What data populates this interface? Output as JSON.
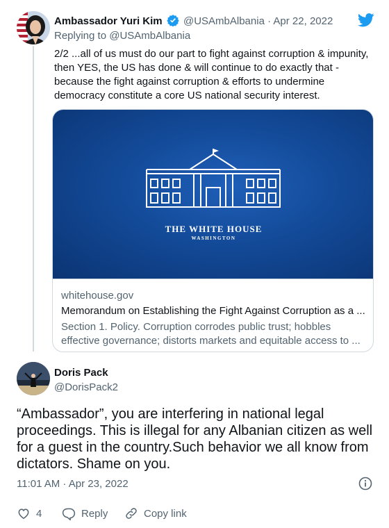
{
  "tweet1": {
    "display_name": "Ambassador Yuri Kim",
    "handle_date": "@USAmbAlbania · Apr 22, 2022",
    "replying_prefix": "Replying to ",
    "replying_handle": "@USAmbAlbania",
    "text": "2/2 ...all of us must do our part to fight against corruption & impunity, then YES, the US has done & will continue to do exactly that - because the fight against corruption & efforts to undermine democracy constitute a core US national security interest.",
    "card": {
      "image_title": "THE WHITE HOUSE",
      "image_subtitle": "WASHINGTON",
      "domain": "whitehouse.gov",
      "title": "Memorandum on Establishing the Fight Against Corruption as a ...",
      "description": "Section 1.  Policy.  Corruption corrodes public trust; hobbles effective governance; distorts markets and equitable access to ..."
    }
  },
  "tweet2": {
    "display_name": "Doris Pack",
    "handle": "@DorisPack2",
    "text": "“Ambassador”, you are  interfering in national legal proceedings. This is illegal for any Albanian citizen as well for a guest in the country.Such behavior we all know from dictators. Shame on you.",
    "timestamp": "11:01 AM · Apr 23, 2022",
    "actions": {
      "like_count": "4",
      "reply_label": "Reply",
      "copy_link_label": "Copy link"
    }
  },
  "colors": {
    "twitter_blue": "#1d9bf0",
    "text_primary": "#0f1419",
    "text_secondary": "#536471",
    "border": "#cfd9de",
    "card_image_blue": "#134a98"
  },
  "icons": [
    "twitter-bird-icon",
    "verified-badge-icon",
    "white-house-icon",
    "info-icon",
    "heart-icon",
    "reply-icon",
    "link-icon"
  ]
}
